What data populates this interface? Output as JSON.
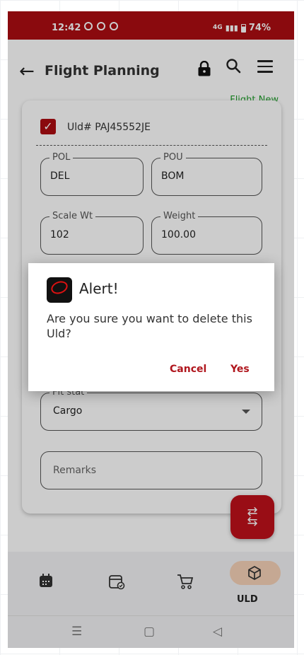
{
  "status_bar": {
    "time": "12:42",
    "battery": "74%",
    "network": "4G",
    "icons": [
      "whatsapp-icon",
      "chrome-icon",
      "chrome-icon"
    ]
  },
  "header": {
    "title": "Flight Planning",
    "subtitle_link": "Flight New",
    "icons": [
      "back-arrow-icon",
      "lock-icon",
      "search-icon",
      "menu-icon"
    ]
  },
  "form": {
    "uld_label": "Uld# PAJ45552JE",
    "pol_label": "POL",
    "pol_value": "DEL",
    "pou_label": "POU",
    "pou_value": "BOM",
    "scale_wt_label": "Scale Wt",
    "scale_wt_value": "102",
    "weight_label": "Weight",
    "weight_value": "100.00",
    "flt_stat_label": "Flt stat",
    "flt_stat_value": "Cargo",
    "remarks_placeholder": "Remarks"
  },
  "bottom_nav": {
    "active_label": "ULD",
    "items": [
      "calendar-icon",
      "calendar-check-icon",
      "cart-icon",
      "cube-icon"
    ]
  },
  "dialog": {
    "title": "Alert!",
    "message": "Are you sure you want to delete this Uld?",
    "cancel_label": "Cancel",
    "confirm_label": "Yes"
  },
  "colors": {
    "brand_red": "#ad0d12",
    "accent_green": "#1f9d2b",
    "active_pill": "#f7d3b8"
  }
}
